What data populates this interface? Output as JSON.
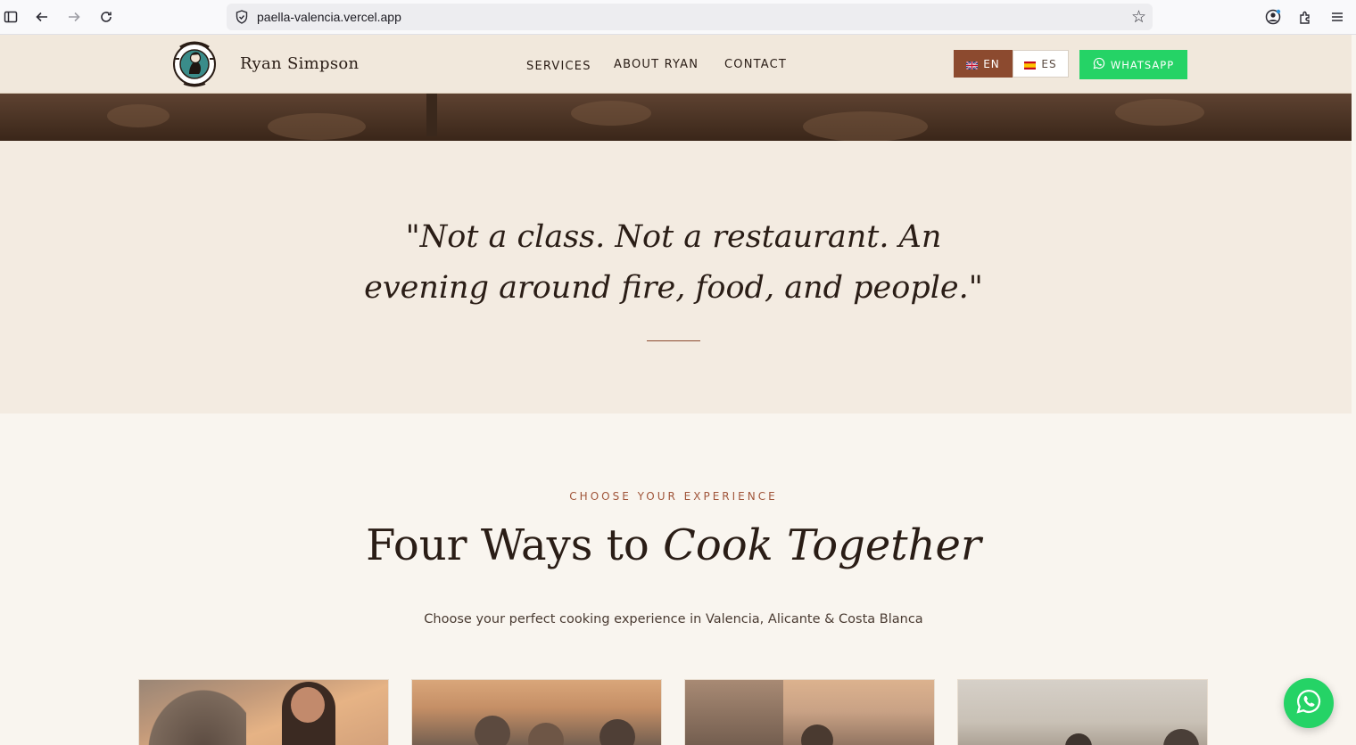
{
  "browser": {
    "url": "paella-valencia.vercel.app"
  },
  "header": {
    "brand": "Ryan Simpson",
    "logo_alt": "Ryan's rice.com Experience",
    "nav": [
      {
        "label": "SERVICES"
      },
      {
        "label": "ABOUT RYAN"
      },
      {
        "label": "CONTACT"
      }
    ],
    "languages": [
      {
        "code": "EN",
        "active": true
      },
      {
        "code": "ES",
        "active": false
      }
    ],
    "whatsapp_label": "WHATSAPP"
  },
  "quote": {
    "line1": "\"Not a class. Not a restaurant. An",
    "line2": "evening around fire, food, and people.\""
  },
  "services": {
    "eyebrow": "CHOOSE YOUR EXPERIENCE",
    "heading_plain": "Four Ways to ",
    "heading_italic": "Cook Together",
    "subtitle": "Choose your perfect cooking experience in Valencia, Alicante & Costa Blanca"
  },
  "colors": {
    "accent": "#8c4a2f",
    "whatsapp": "#25d366",
    "header_bg": "#f1e8dc",
    "quote_bg": "#f3ebe1",
    "page_bg": "#f9f5ef"
  }
}
